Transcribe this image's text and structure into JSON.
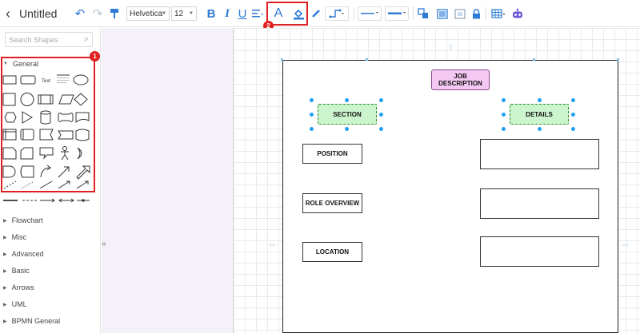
{
  "document": {
    "title": "Untitled"
  },
  "toolbar": {
    "font_family": "Helvetica",
    "font_size": "12",
    "badge_text_color": "2",
    "icons": [
      "undo-icon",
      "redo-icon",
      "format-painter-icon",
      "bold-icon",
      "italic-icon",
      "underline-icon",
      "align-icon",
      "font-color-icon",
      "fill-color-icon",
      "line-color-icon",
      "connector-icon",
      "line-style-icon",
      "line-width-icon",
      "arrange-icon",
      "image-icon",
      "lock-icon",
      "table-icon",
      "ai-robot-icon"
    ]
  },
  "sidebar": {
    "search_placeholder": "Search Shapes",
    "badge_general": "1",
    "general_label": "General",
    "general_text_shape": "Text",
    "categories": [
      "Flowchart",
      "Misc",
      "Advanced",
      "Basic",
      "Arrows",
      "UML",
      "BPMN General"
    ]
  },
  "diagram": {
    "job_description": "JOB DESCRIPTION",
    "section": "SECTION",
    "details": "DETAILS",
    "position": "POSITION",
    "role_overview": "ROLE OVERVIEW",
    "location": "LOCATION"
  },
  "colors": {
    "accent": "#2e7bd6",
    "highlight": "#e02020",
    "job_fill": "#f3c8f3",
    "section_fill": "#cdf5cd",
    "handle": "#1fa0f0"
  }
}
